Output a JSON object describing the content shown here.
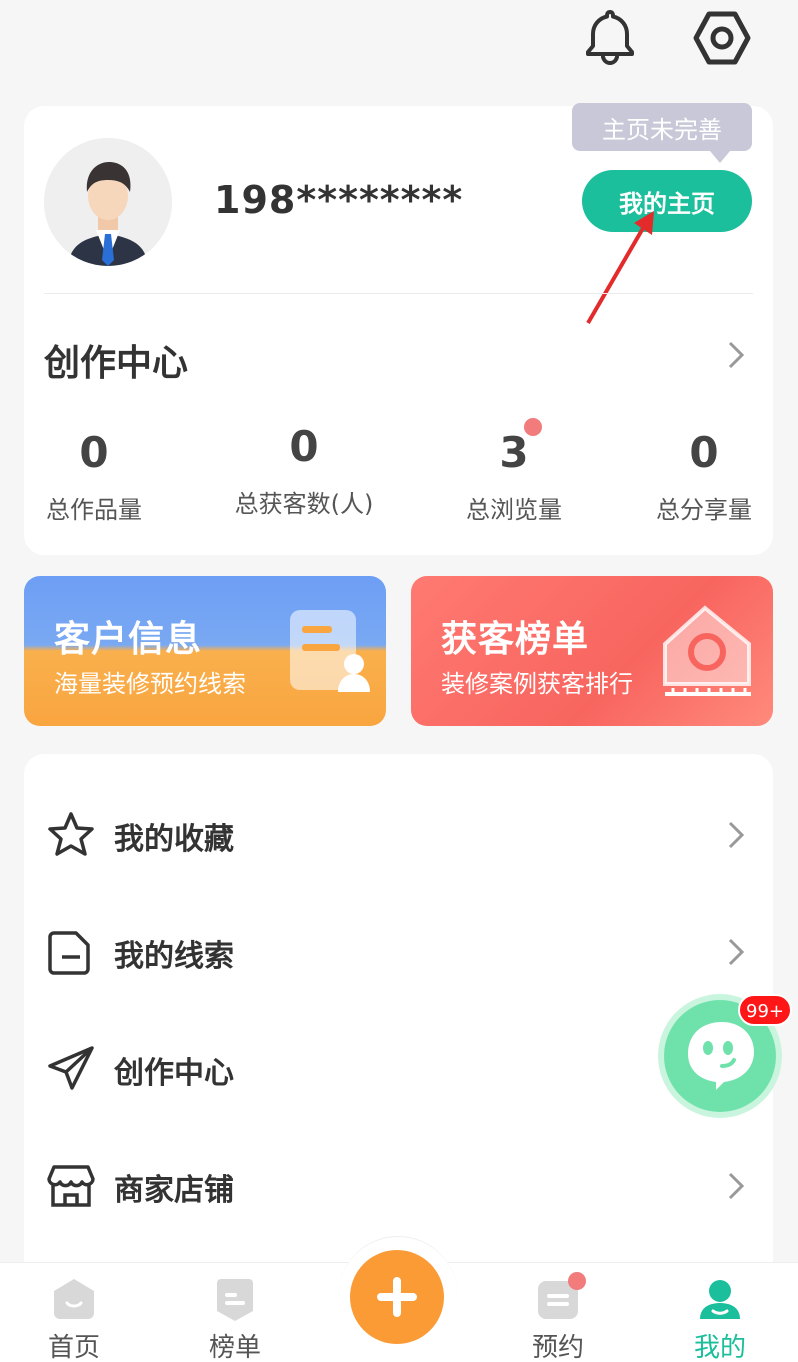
{
  "top": {
    "icons": [
      "bell-icon",
      "settings-icon"
    ]
  },
  "profile": {
    "phone": "198********",
    "tip": "主页未完善",
    "home_button": "我的主页",
    "section_title": "创作中心",
    "stats": [
      {
        "value": "0",
        "label": "总作品量"
      },
      {
        "value": "0",
        "label": "总获客数(人)"
      },
      {
        "value": "3",
        "label": "总浏览量"
      },
      {
        "value": "0",
        "label": "总分享量"
      }
    ]
  },
  "banners": [
    {
      "title": "客户信息",
      "subtitle": "海量装修预约线索"
    },
    {
      "title": "获客榜单",
      "subtitle": "装修案例获客排行"
    }
  ],
  "menu": [
    {
      "label": "我的收藏",
      "icon": "star-icon"
    },
    {
      "label": "我的线索",
      "icon": "document-icon"
    },
    {
      "label": "创作中心",
      "icon": "paper-plane-icon"
    },
    {
      "label": "商家店铺",
      "icon": "store-icon"
    }
  ],
  "chat": {
    "badge": "99+"
  },
  "tabs": [
    {
      "label": "首页"
    },
    {
      "label": "榜单"
    },
    {
      "label": "预约"
    },
    {
      "label": "我的"
    }
  ],
  "colors": {
    "accent": "#1bbf9b",
    "orange": "#fa9b36",
    "red_banner": "#f8655f"
  }
}
